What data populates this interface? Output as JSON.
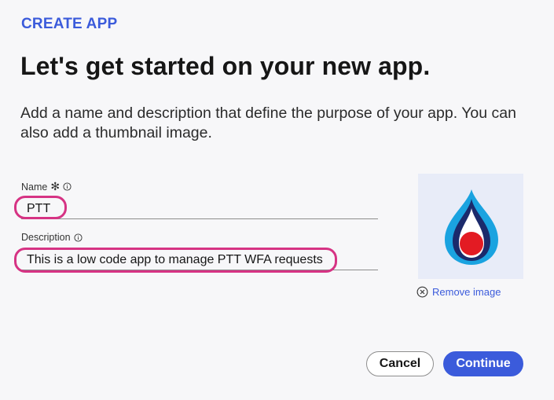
{
  "header": {
    "eyebrow": "CREATE APP",
    "title": "Let's get started on your new app.",
    "subtitle": "Add a name and description that define the purpose of your app. You can also add a thumbnail image."
  },
  "form": {
    "name": {
      "label": "Name",
      "required_marker": "✻",
      "value": "PTT"
    },
    "description": {
      "label": "Description",
      "value": "This is a low code app to manage PTT WFA requests"
    }
  },
  "thumbnail": {
    "remove_label": "Remove image"
  },
  "actions": {
    "cancel_label": "Cancel",
    "continue_label": "Continue"
  },
  "colors": {
    "accent": "#3b5bdb",
    "highlight": "#d63384",
    "logo_blue": "#1aa3e0",
    "logo_navy": "#1b2a6b",
    "logo_red": "#e31b23"
  },
  "icons": [
    "info-icon",
    "close-circle-icon",
    "app-logo"
  ]
}
